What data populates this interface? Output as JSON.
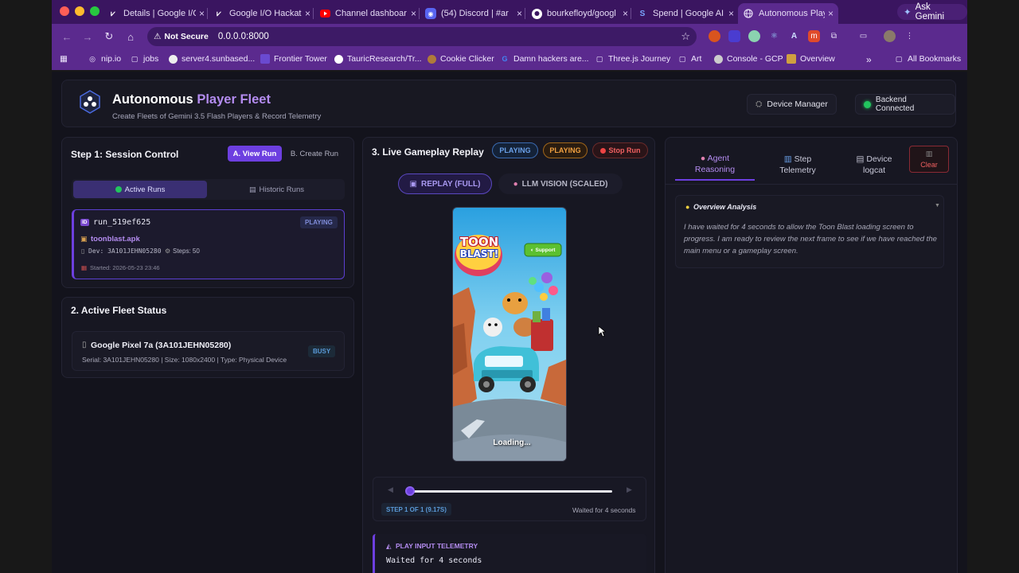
{
  "browser": {
    "tabs": [
      {
        "icon": "gemini-icon",
        "title": "Details | Google I/O"
      },
      {
        "icon": "gemini-icon",
        "title": "Google I/O Hackat"
      },
      {
        "icon": "youtube-icon",
        "title": "Channel dashboar"
      },
      {
        "icon": "discord-icon",
        "title": "(54) Discord | #ar"
      },
      {
        "icon": "github-icon",
        "title": "bourkefloyd/googl"
      },
      {
        "icon": "spend-icon",
        "title": "Spend | Google AI"
      },
      {
        "icon": "globe-icon",
        "title": "Autonomous Playe"
      }
    ],
    "ask_gemini": "Ask Gemini",
    "not_secure": "Not Secure",
    "url": "0.0.0.0:8000",
    "bookmarks": [
      "nip.io",
      "jobs",
      "server4.sunbased...",
      "Frontier Tower",
      "TauricResearch/Tr...",
      "Cookie Clicker",
      "Damn hackers are...",
      "Three.js Journey",
      "Art",
      "Console - GCP",
      "Overview"
    ],
    "all_bookmarks": "All Bookmarks",
    "overflow": "»"
  },
  "header": {
    "title_main": "Autonomous ",
    "title_accent": "Player Fleet",
    "subtitle": "Create Fleets of Gemini 3.5 Flash Players & Record Telemetry",
    "device_manager": "Device Manager",
    "backend_status": "Backend Connected"
  },
  "session": {
    "title": "Step 1: Session Control",
    "view_run": "A. View Run",
    "create_run": "B. Create Run",
    "active_runs": "Active Runs",
    "historic_runs": "Historic Runs",
    "run": {
      "id_icon": "ID",
      "id": "run_519ef625",
      "status": "PLAYING",
      "apk": "toonblast.apk",
      "device": "Dev: 3A101JEHN05280",
      "steps": "Steps: 50",
      "started": "Started: 2026-05-23 23:46"
    }
  },
  "fleet": {
    "title": "2. Active Fleet Status",
    "device_name": "Google Pixel 7a (3A101JEHN05280)",
    "device_meta": "Serial: 3A101JEHN05280 | Size: 1080x2400 | Type: Physical Device",
    "status": "BUSY"
  },
  "replay": {
    "title": "3. Live Gameplay Replay",
    "pill_blue": "PLAYING",
    "pill_orange": "PLAYING",
    "stop": "Stop Run",
    "mode_full": "REPLAY (FULL)",
    "mode_vision": "LLM VISION (SCALED)",
    "game_logo_1": "TOON",
    "game_logo_2": "BLAST!",
    "support": "Support",
    "loading": "Loading...",
    "step_label": "STEP 1 OF 1 (9.17S)",
    "step_status": "Waited for 4 seconds",
    "slider_progress": 0.0,
    "telemetry_title": "PLAY INPUT TELEMETRY",
    "telemetry_text": "Waited for 4 seconds"
  },
  "right": {
    "tab_reasoning": [
      "Agent",
      "Reasoning"
    ],
    "tab_telemetry": [
      "Step",
      "Telemetry"
    ],
    "tab_logcat": [
      "Device",
      "logcat"
    ],
    "clear": "Clear",
    "analysis_title": "Overview Analysis",
    "analysis_text": "I have waited for 4 seconds to allow the Toon Blast loading screen to progress. I am ready to review the next frame to see if we have reached the main menu or a gameplay screen."
  },
  "colors": {
    "accent": "#6d3fe0",
    "tab_strip": "#3a1560",
    "toolbar": "#5b2a8e",
    "success": "#22c55e",
    "danger": "#ef4444",
    "warning": "#f59e0b"
  }
}
